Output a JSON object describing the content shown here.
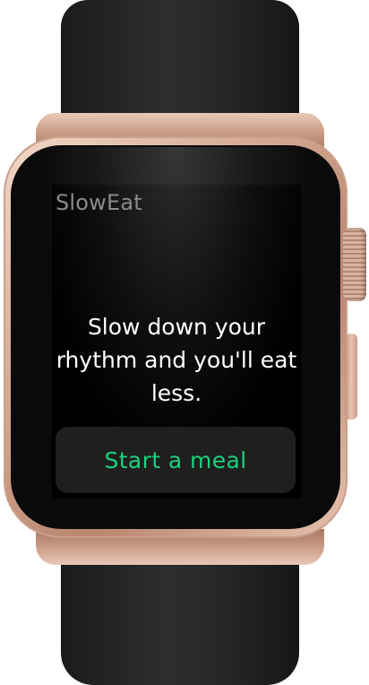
{
  "app": {
    "title": "SlowEat"
  },
  "main": {
    "message": "Slow down your rhythm and you'll eat less.",
    "start_button_label": "Start a meal"
  },
  "colors": {
    "background": "#000000",
    "title": "#8a8a8a",
    "message": "#ffffff",
    "button_bg": "#1f1f1f",
    "accent": "#19d27e"
  }
}
